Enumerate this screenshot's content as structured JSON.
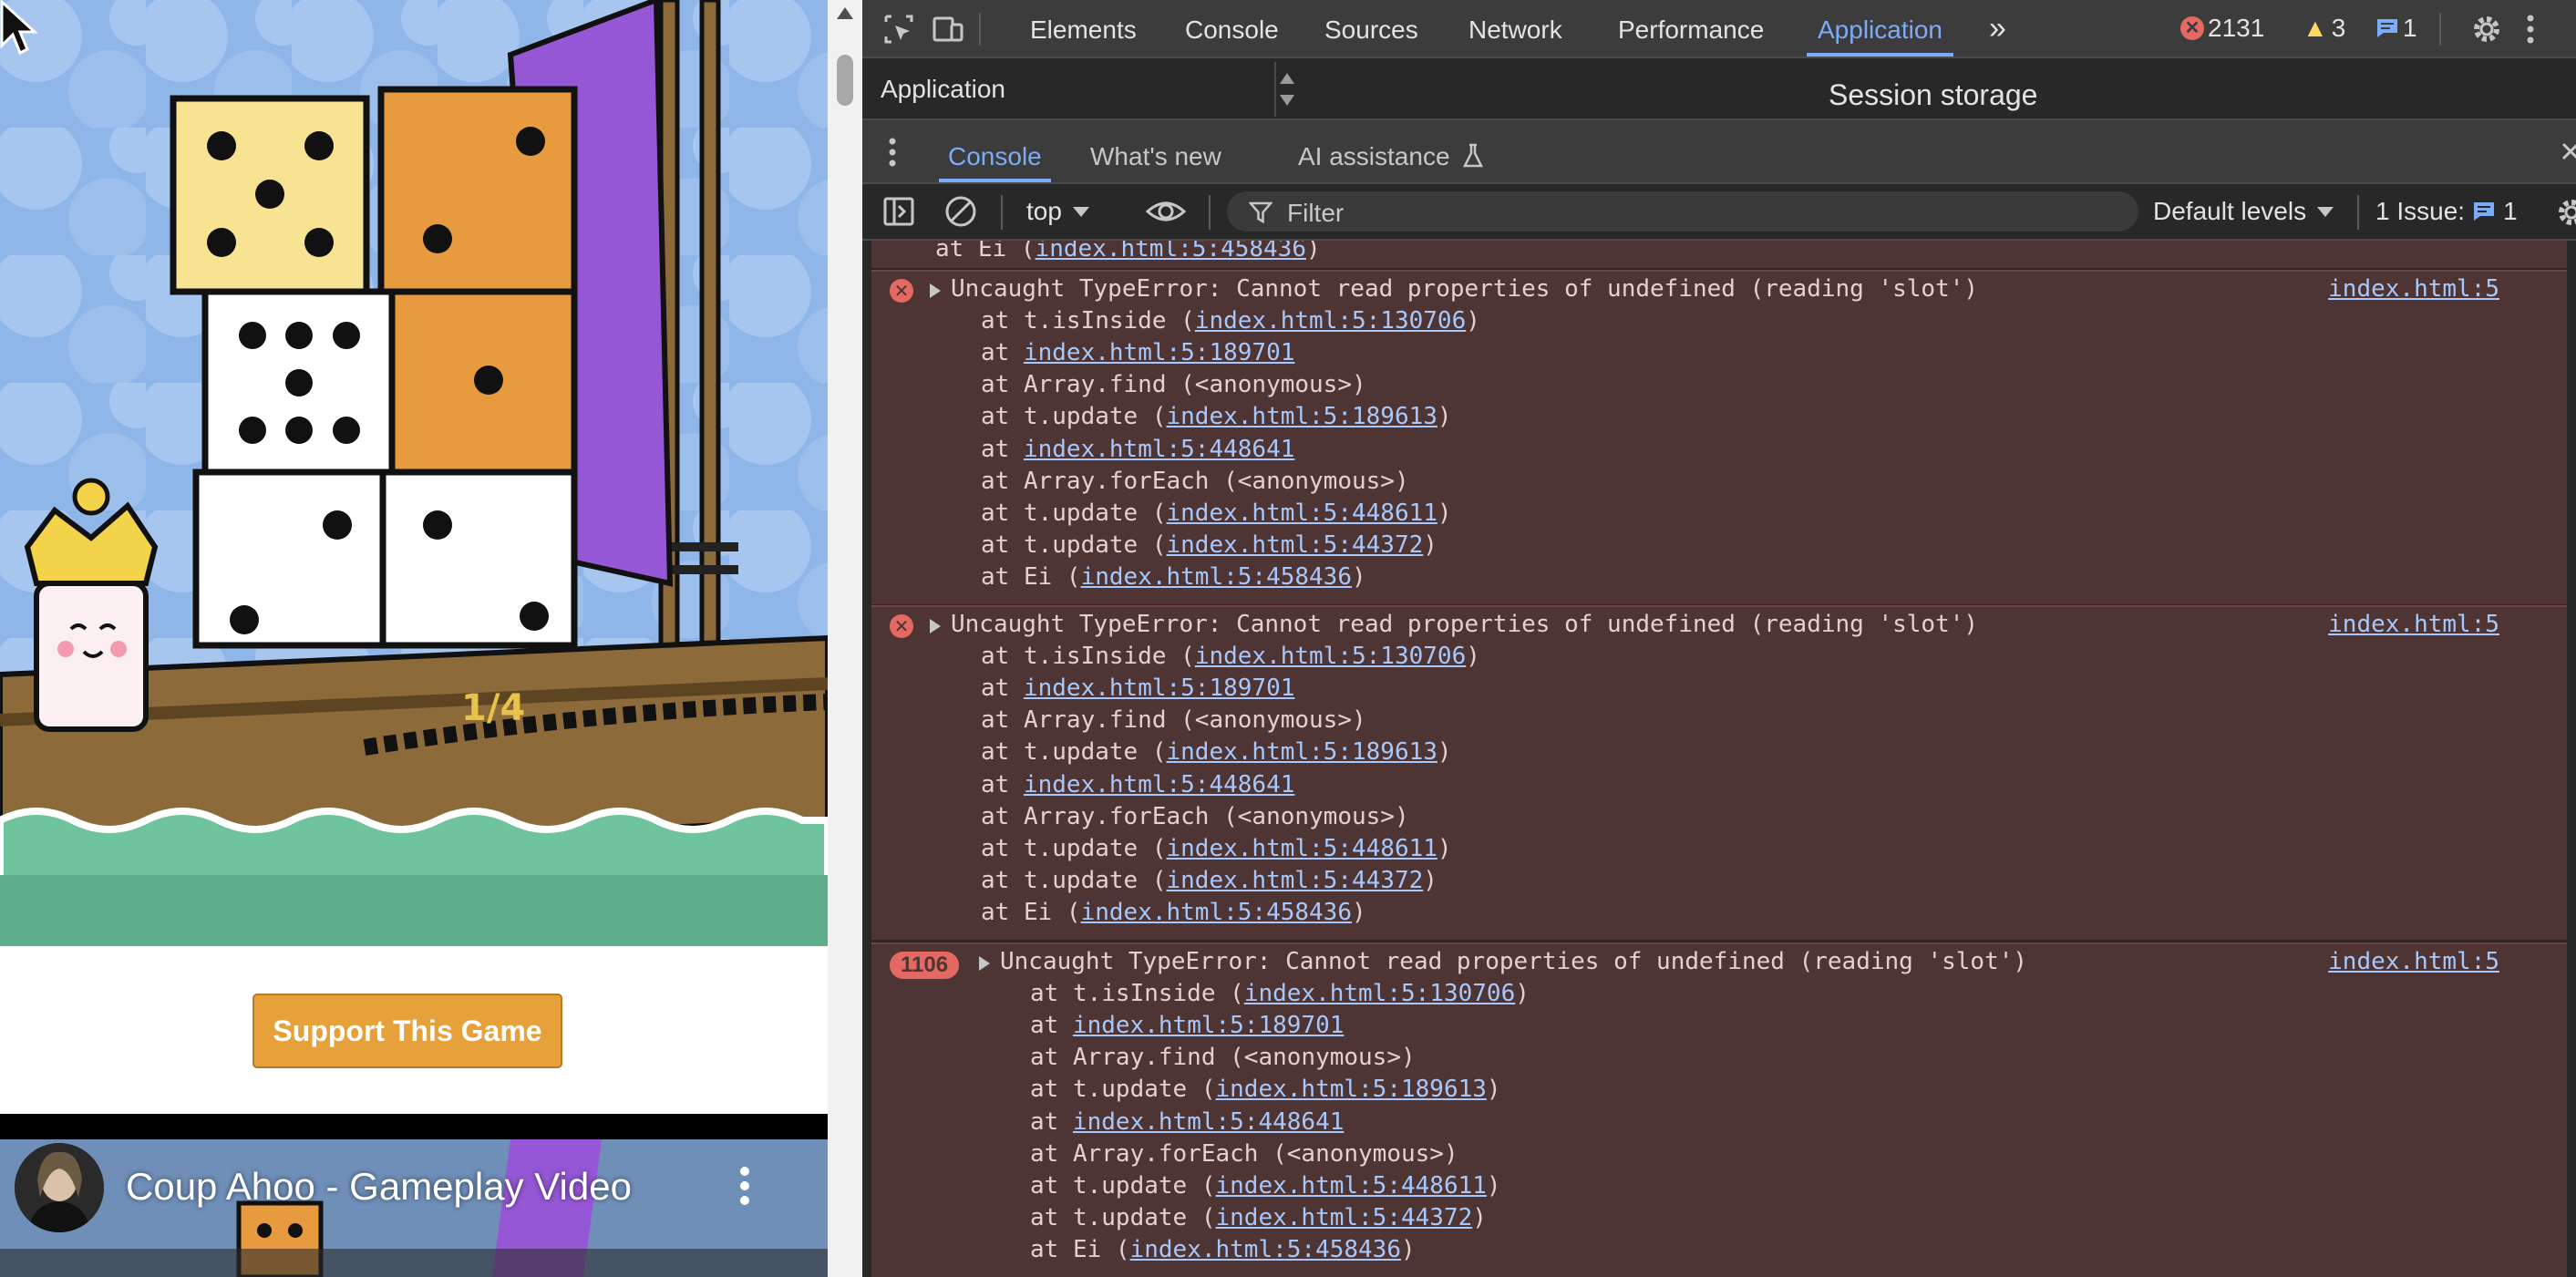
{
  "game": {
    "support_button": "Support This Game",
    "video": {
      "title": "Coup Ahoo - Gameplay Video"
    },
    "sail_marker": "1/4"
  },
  "devtools": {
    "toolbar": {
      "tabs": [
        "Elements",
        "Console",
        "Sources",
        "Network",
        "Performance",
        "Application"
      ],
      "active_tab": "Application",
      "more_tabs": "»",
      "error_count": "2131",
      "warning_count": "3",
      "message_count": "1"
    },
    "application_panel": {
      "sidebar_label": "Application",
      "heading": "Session storage"
    },
    "drawer": {
      "tabs": [
        "Console",
        "What's new",
        "AI assistance"
      ],
      "active_tab": "Console",
      "ai_icon": "flask-icon"
    },
    "console_toolbar": {
      "context": "top",
      "filter_placeholder": "Filter",
      "levels": "Default levels",
      "issues_label": "1 Issue:",
      "issues_count": "1"
    },
    "console": {
      "partial_top_line": {
        "prefix": "at Ei (",
        "link": "index.html:5:458436",
        "suffix": ")"
      },
      "entries": [
        {
          "repeat": "",
          "message": "Uncaught TypeError: Cannot read properties of undefined (reading 'slot')",
          "source": "index.html:5",
          "stack": [
            {
              "prefix": "at t.isInside (",
              "link": "index.html:5:130706",
              "suffix": ")"
            },
            {
              "prefix": "at ",
              "link": "index.html:5:189701",
              "suffix": ""
            },
            {
              "prefix": "at Array.find (<anonymous>)",
              "link": "",
              "suffix": ""
            },
            {
              "prefix": "at t.update (",
              "link": "index.html:5:189613",
              "suffix": ")"
            },
            {
              "prefix": "at ",
              "link": "index.html:5:448641",
              "suffix": ""
            },
            {
              "prefix": "at Array.forEach (<anonymous>)",
              "link": "",
              "suffix": ""
            },
            {
              "prefix": "at t.update (",
              "link": "index.html:5:448611",
              "suffix": ")"
            },
            {
              "prefix": "at t.update (",
              "link": "index.html:5:44372",
              "suffix": ")"
            },
            {
              "prefix": "at Ei (",
              "link": "index.html:5:458436",
              "suffix": ")"
            }
          ]
        },
        {
          "repeat": "",
          "message": "Uncaught TypeError: Cannot read properties of undefined (reading 'slot')",
          "source": "index.html:5",
          "stack": [
            {
              "prefix": "at t.isInside (",
              "link": "index.html:5:130706",
              "suffix": ")"
            },
            {
              "prefix": "at ",
              "link": "index.html:5:189701",
              "suffix": ""
            },
            {
              "prefix": "at Array.find (<anonymous>)",
              "link": "",
              "suffix": ""
            },
            {
              "prefix": "at t.update (",
              "link": "index.html:5:189613",
              "suffix": ")"
            },
            {
              "prefix": "at ",
              "link": "index.html:5:448641",
              "suffix": ""
            },
            {
              "prefix": "at Array.forEach (<anonymous>)",
              "link": "",
              "suffix": ""
            },
            {
              "prefix": "at t.update (",
              "link": "index.html:5:448611",
              "suffix": ")"
            },
            {
              "prefix": "at t.update (",
              "link": "index.html:5:44372",
              "suffix": ")"
            },
            {
              "prefix": "at Ei (",
              "link": "index.html:5:458436",
              "suffix": ")"
            }
          ]
        },
        {
          "repeat": "1106",
          "message": "Uncaught TypeError: Cannot read properties of undefined (reading 'slot')",
          "source": "index.html:5",
          "stack": [
            {
              "prefix": "at t.isInside (",
              "link": "index.html:5:130706",
              "suffix": ")"
            },
            {
              "prefix": "at ",
              "link": "index.html:5:189701",
              "suffix": ""
            },
            {
              "prefix": "at Array.find (<anonymous>)",
              "link": "",
              "suffix": ""
            },
            {
              "prefix": "at t.update (",
              "link": "index.html:5:189613",
              "suffix": ")"
            },
            {
              "prefix": "at ",
              "link": "index.html:5:448641",
              "suffix": ""
            },
            {
              "prefix": "at Array.forEach (<anonymous>)",
              "link": "",
              "suffix": ""
            },
            {
              "prefix": "at t.update (",
              "link": "index.html:5:448611",
              "suffix": ")"
            },
            {
              "prefix": "at t.update (",
              "link": "index.html:5:44372",
              "suffix": ")"
            },
            {
              "prefix": "at Ei (",
              "link": "index.html:5:458436",
              "suffix": ")"
            }
          ]
        }
      ]
    }
  },
  "colors": {
    "error_bg": "#4e3534",
    "link": "#a8c7fa",
    "active_tab": "#7cacf8",
    "support_button": "#e7a13b"
  }
}
